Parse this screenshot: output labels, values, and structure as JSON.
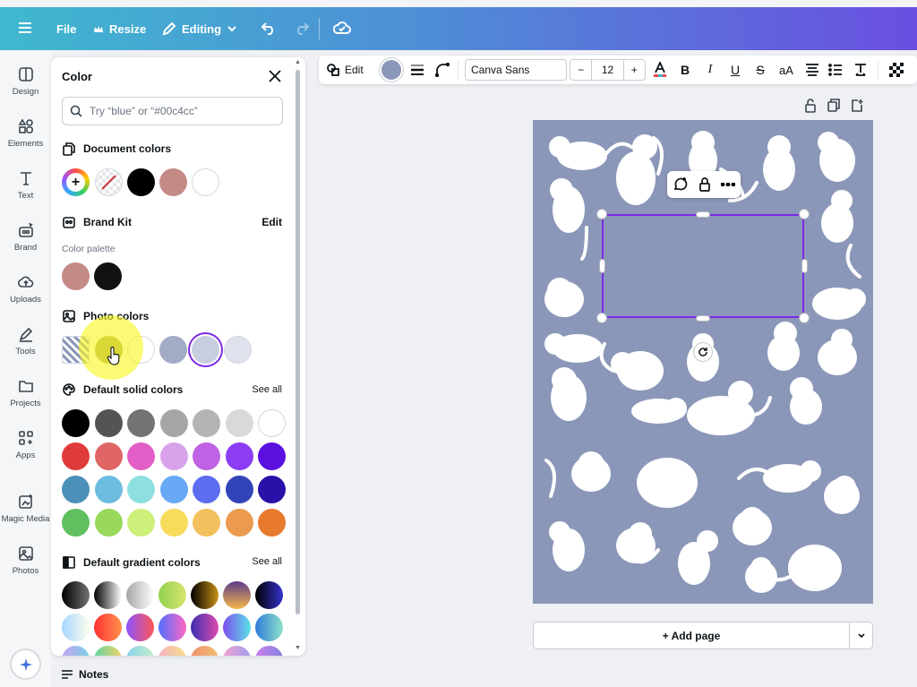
{
  "topbar": {
    "file_label": "File",
    "resize_label": "Resize",
    "editing_label": "Editing"
  },
  "rail": {
    "items": [
      {
        "label": "Design",
        "icon": "design-icon"
      },
      {
        "label": "Elements",
        "icon": "elements-icon"
      },
      {
        "label": "Text",
        "icon": "text-icon"
      },
      {
        "label": "Brand",
        "icon": "brand-icon"
      },
      {
        "label": "Uploads",
        "icon": "uploads-icon"
      },
      {
        "label": "Tools",
        "icon": "tools-icon"
      },
      {
        "label": "Projects",
        "icon": "projects-icon"
      },
      {
        "label": "Apps",
        "icon": "apps-icon"
      },
      {
        "label": "Magic Media",
        "icon": "magic-media-icon"
      },
      {
        "label": "Photos",
        "icon": "photos-icon"
      }
    ]
  },
  "panel": {
    "title": "Color",
    "search_placeholder": "Try “blue” or “#00c4cc”",
    "document_colors": {
      "title": "Document colors",
      "swatches": [
        "#000000",
        "#c48b86",
        "#ffffff"
      ]
    },
    "brand_kit": {
      "title": "Brand Kit",
      "edit_label": "Edit",
      "palette_label": "Color palette",
      "swatches": [
        "#c48b86",
        "#111111"
      ]
    },
    "photo_colors": {
      "title": "Photo colors",
      "swatches": [
        "#a8a760",
        "#ffffff",
        "#a3acc6",
        "#c9cde0",
        "#dfe1ec"
      ],
      "selected_index": 3
    },
    "default_solid": {
      "title": "Default solid colors",
      "see_all": "See all",
      "rows": [
        [
          "#000000",
          "#545454",
          "#737373",
          "#a6a6a6",
          "#b4b4b4",
          "#d9d9d9",
          "#ffffff"
        ],
        [
          "#e03b3b",
          "#e06666",
          "#e35fc7",
          "#d9a3ec",
          "#bf62e3",
          "#8c3df3",
          "#5c10e0"
        ],
        [
          "#4a90b8",
          "#6cbde0",
          "#8ee0e0",
          "#68a8f5",
          "#5e6cf0",
          "#3344b8",
          "#2a0fa8"
        ],
        [
          "#60c060",
          "#98d85a",
          "#ccf07a",
          "#f7dc5b",
          "#f2c05c",
          "#ec9a4f",
          "#e87a2e"
        ]
      ]
    },
    "default_gradient": {
      "title": "Default gradient colors",
      "see_all": "See all"
    }
  },
  "notes_label": "Notes",
  "toolbar": {
    "edit_label": "Edit",
    "font_name": "Canva Sans",
    "font_size": "12",
    "minus": "−",
    "plus": "+",
    "fill_color": "#8b97b8"
  },
  "canvas": {
    "page_color": "#8b97b8",
    "add_page_label": "+ Add page"
  }
}
